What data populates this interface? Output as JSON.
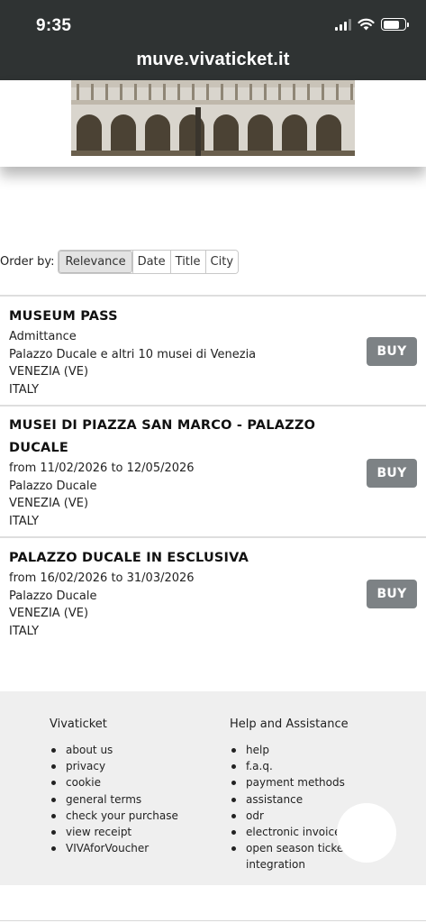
{
  "status": {
    "time": "9:35"
  },
  "browser": {
    "url": "muve.vivaticket.it"
  },
  "hero": {
    "image": "Palazzo Ducale facade"
  },
  "order": {
    "label": "Order by:",
    "options": [
      "Relevance",
      "Date",
      "Title",
      "City"
    ],
    "selected": "Relevance"
  },
  "events": [
    {
      "title": "MUSEUM PASS",
      "lines": [
        "Admittance",
        "Palazzo Ducale e altri 10 musei di Venezia",
        "VENEZIA (VE)",
        "ITALY"
      ],
      "buy_label": "BUY"
    },
    {
      "title_line1": "MUSEI DI PIAZZA SAN MARCO - PALAZZO",
      "title_line2": "DUCALE",
      "lines": [
        "from 11/02/2026 to 12/05/2026",
        "Palazzo Ducale",
        "VENEZIA (VE)",
        "ITALY"
      ],
      "buy_label": "BUY"
    },
    {
      "title": "PALAZZO DUCALE IN ESCLUSIVA",
      "lines": [
        "from 16/02/2026 to 31/03/2026",
        "Palazzo Ducale",
        "VENEZIA (VE)",
        "ITALY"
      ],
      "buy_label": "BUY"
    }
  ],
  "footer": {
    "col1": {
      "heading": "Vivaticket",
      "links": [
        "about us",
        "privacy",
        "cookie",
        "general terms",
        "check your purchase",
        "view receipt",
        "VIVAforVoucher"
      ]
    },
    "col2": {
      "heading": "Help and Assistance",
      "links": [
        "help",
        "f.a.q.",
        "payment methods",
        "assistance",
        "odr",
        "electronic invoice",
        "open season ticket",
        "integration"
      ]
    }
  }
}
